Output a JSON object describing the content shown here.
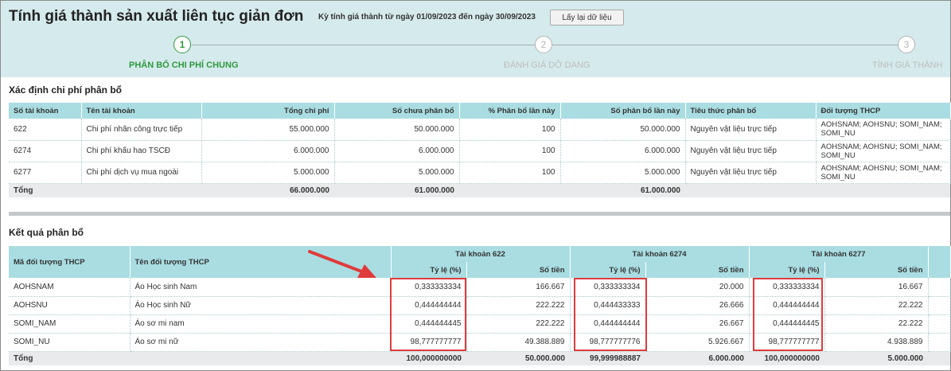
{
  "header": {
    "title": "Tính giá thành sản xuất liên tục giản đơn",
    "period": "Kỳ tính giá thành từ ngày 01/09/2023 đến ngày 30/09/2023",
    "reload_label": "Lấy lại dữ liệu"
  },
  "steps": [
    {
      "number": "1",
      "label": "PHÂN BỔ CHI PHÍ CHUNG",
      "state": "active"
    },
    {
      "number": "2",
      "label": "ĐÁNH GIÁ DỞ DANG",
      "state": "inactive"
    },
    {
      "number": "3",
      "label": "TÍNH GIÁ THÀNH",
      "state": "inactive"
    }
  ],
  "allocation": {
    "title": "Xác định chi phí phân bổ",
    "headers": [
      "Số tài khoản",
      "Tên tài khoản",
      "Tổng chi phí",
      "Số chưa phân bổ",
      "% Phân bổ lần này",
      "Số phân bổ lần này",
      "Tiêu thức phân bổ",
      "Đối tượng THCP"
    ],
    "rows": [
      [
        "622",
        "Chi phí nhân công trực tiếp",
        "55.000.000",
        "50.000.000",
        "100",
        "50.000.000",
        "Nguyên vật liệu trực tiếp",
        "AOHSNAM; AOHSNU; SOMI_NAM; SOMI_NU"
      ],
      [
        "6274",
        "Chi phí khấu hao TSCĐ",
        "6.000.000",
        "6.000.000",
        "100",
        "6.000.000",
        "Nguyên vật liệu trực tiếp",
        "AOHSNAM; AOHSNU; SOMI_NAM; SOMI_NU"
      ],
      [
        "6277",
        "Chi phí dịch vụ mua ngoài",
        "5.000.000",
        "5.000.000",
        "100",
        "5.000.000",
        "Nguyên vật liệu trực tiếp",
        "AOHSNAM; AOHSNU; SOMI_NAM; SOMI_NU"
      ]
    ],
    "total": {
      "label": "Tổng",
      "total_cost": "66.000.000",
      "unallocated": "61.000.000",
      "allocated": "61.000.000"
    }
  },
  "result": {
    "title": "Kết quả phân bổ",
    "col_code": "Mã đối tượng THCP",
    "col_name": "Tên đối tượng THCP",
    "groups": [
      "Tài khoản 622",
      "Tài khoản 6274",
      "Tài khoản 6277"
    ],
    "sub_rate": "Tỷ lệ (%)",
    "sub_amount": "Số tiền",
    "rows": [
      [
        "AOHSNAM",
        "Áo Học sinh Nam",
        "0,333333334",
        "166.667",
        "0,333333334",
        "20.000",
        "0,333333334",
        "16.667"
      ],
      [
        "AOHSNU",
        "Áo Học sinh Nữ",
        "0,444444444",
        "222.222",
        "0,444433333",
        "26.666",
        "0,444444444",
        "22.222"
      ],
      [
        "SOMI_NAM",
        "Áo sơ mi nam",
        "0,444444445",
        "222.222",
        "0,444444444",
        "26.667",
        "0,444444445",
        "22.222"
      ],
      [
        "SOMI_NU",
        "Áo sơ mi nữ",
        "98,777777777",
        "49.388.889",
        "98,777777776",
        "5.926.667",
        "98,777777777",
        "4.938.889"
      ]
    ],
    "total": [
      "Tổng",
      "100,000000000",
      "50.000.000",
      "99,999988887",
      "6.000.000",
      "100,000000000",
      "5.000.000"
    ]
  }
}
